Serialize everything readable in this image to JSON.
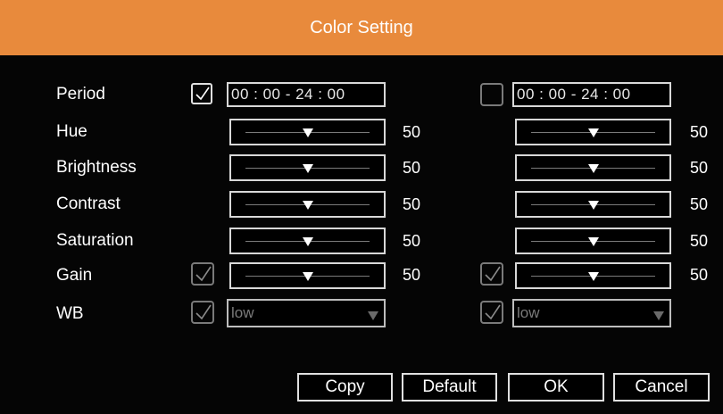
{
  "window": {
    "title": "Color Setting"
  },
  "accent_color": "#e88a3c",
  "labels": {
    "period": "Period",
    "hue": "Hue",
    "brightness": "Brightness",
    "contrast": "Contrast",
    "saturation": "Saturation",
    "gain": "Gain",
    "wb": "WB"
  },
  "left": {
    "period_enabled": true,
    "period": "00 : 00 - 24 : 00",
    "hue": "50",
    "brightness": "50",
    "contrast": "50",
    "saturation": "50",
    "gain_enabled": true,
    "gain": "50",
    "wb_enabled": true,
    "wb": "low"
  },
  "right": {
    "period_enabled": false,
    "period": "00 : 00 - 24 : 00",
    "hue": "50",
    "brightness": "50",
    "contrast": "50",
    "saturation": "50",
    "gain_enabled": true,
    "gain": "50",
    "wb_enabled": true,
    "wb": "low"
  },
  "buttons": {
    "copy": "Copy",
    "default": "Default",
    "ok": "OK",
    "cancel": "Cancel"
  }
}
